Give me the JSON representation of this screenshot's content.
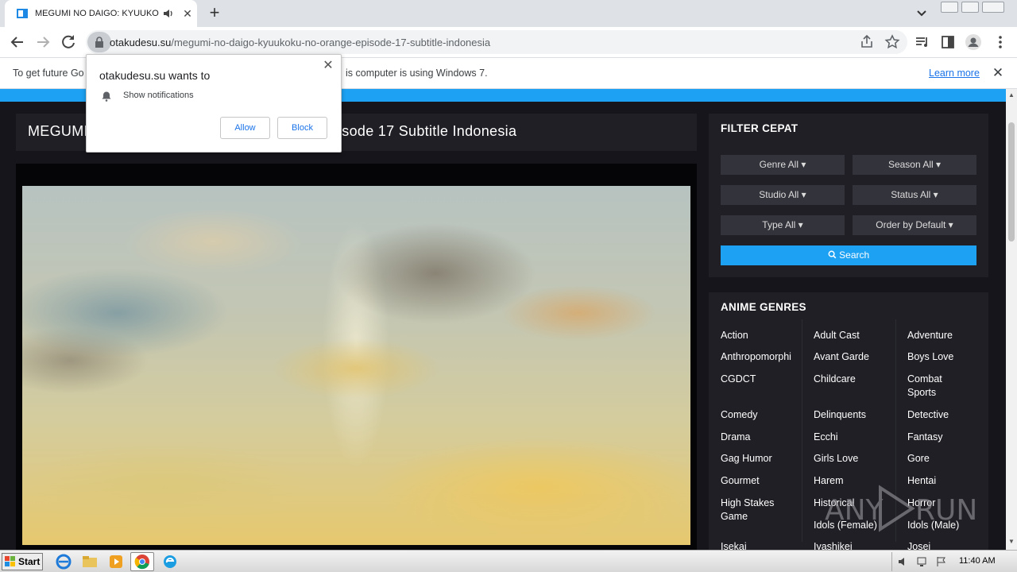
{
  "browser": {
    "tab_title": "MEGUMI NO DAIGO: KYUUKOKU",
    "new_tab": "+",
    "url_host": "otakudesu.su",
    "url_path": "/megumi-no-daigo-kyuukoku-no-orange-episode-17-subtitle-indonesia"
  },
  "infobar": {
    "text_left": "To get future Go",
    "text_right": "is computer is using Windows 7.",
    "learn_more": "Learn more",
    "close": "✕"
  },
  "permission_prompt": {
    "title": "otakudesu.su wants to",
    "permission": "Show notifications",
    "allow": "Allow",
    "block": "Block",
    "close": "✕"
  },
  "page": {
    "episode_title_left": "MEGUMI",
    "episode_title_right": "isode 17 Subtitle Indonesia",
    "accent_color": "#1da1f2"
  },
  "filter": {
    "title": "FILTER CEPAT",
    "genre": "Genre All ▾",
    "season": "Season All ▾",
    "studio": "Studio All ▾",
    "status": "Status All ▾",
    "type": "Type All ▾",
    "order": "Order by Default ▾",
    "search": "Search"
  },
  "genres": {
    "title": "ANIME GENRES",
    "col1": [
      "Action",
      "Anthropomorphi",
      "CGDCT",
      "Comedy",
      "Drama",
      "Gag Humor",
      "Gourmet",
      "High Stakes Game",
      "Isekai"
    ],
    "col2": [
      "Adult Cast",
      "Avant Garde",
      "Childcare",
      "Delinquents",
      "Ecchi",
      "Girls Love",
      "Harem",
      "Historical",
      "Idols (Female)",
      "Iyashikei"
    ],
    "col3": [
      "Adventure",
      "Boys Love",
      "Combat Sports",
      "Detective",
      "Fantasy",
      "Gore",
      "Hentai",
      "Horror",
      "Idols (Male)",
      "Josei"
    ]
  },
  "watermark": {
    "left": "ANY",
    "right": "RUN"
  },
  "taskbar": {
    "start": "Start",
    "clock": "11:40 AM"
  }
}
